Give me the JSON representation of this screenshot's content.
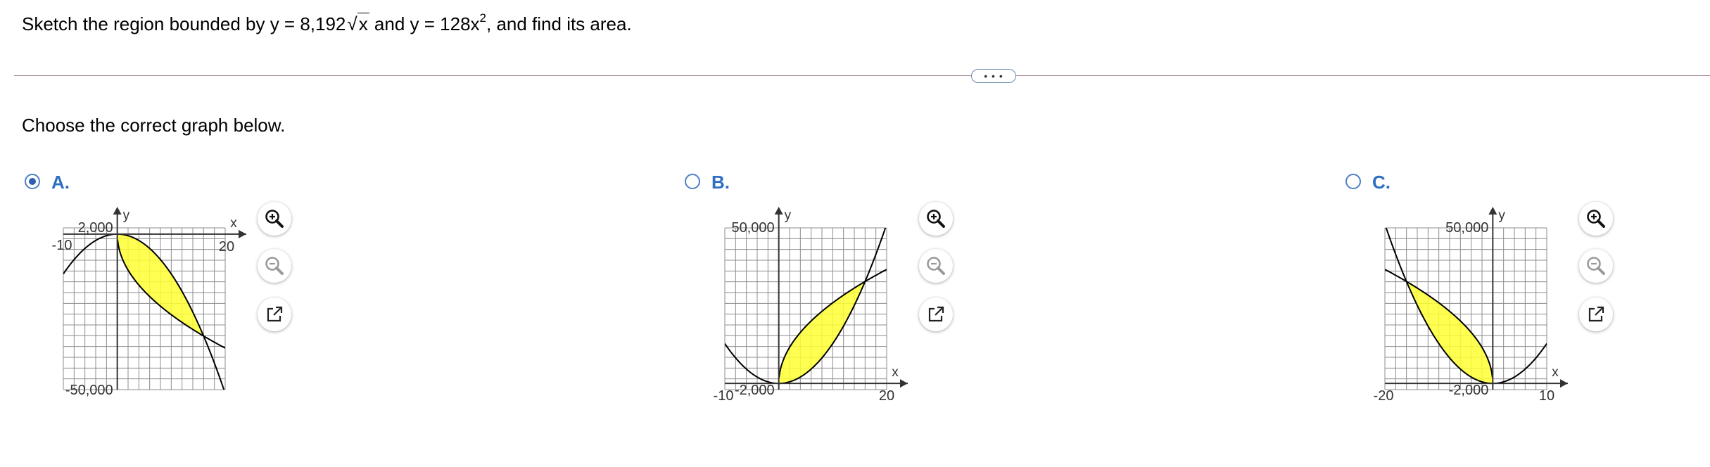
{
  "question": {
    "prefix": "Sketch the region bounded by y = 8,192",
    "radicand": "x",
    "middle": " and y = 128x",
    "exponent": "2",
    "suffix": ", and find its area."
  },
  "more_button": {
    "label": "• • •"
  },
  "prompt": "Choose the correct graph below.",
  "options": [
    {
      "letter": "A.",
      "selected": true,
      "chart": {
        "x_label": "x",
        "y_label": "y",
        "ticks": {
          "top_y": "2,000",
          "bottom_y": "-50,000",
          "left_x": "-10",
          "right_x": "20"
        }
      }
    },
    {
      "letter": "B.",
      "selected": false,
      "chart": {
        "x_label": "x",
        "y_label": "y",
        "ticks": {
          "top_y": "50,000",
          "bottom_y": "-2,000",
          "left_x": "-10",
          "right_x": "20"
        }
      }
    },
    {
      "letter": "C.",
      "selected": false,
      "chart": {
        "x_label": "x",
        "y_label": "y",
        "ticks": {
          "top_y": "50,000",
          "bottom_y": "-2,000",
          "left_x": "-20",
          "right_x": "10"
        }
      }
    }
  ],
  "chart_data": [
    {
      "type": "area",
      "title": "A",
      "xlim": [
        -10,
        20
      ],
      "ylim": [
        -50000,
        2000
      ],
      "series": [
        {
          "x": [
            -10,
            -5,
            0,
            5,
            10,
            15,
            20
          ],
          "y": [
            -12800,
            -3200,
            0,
            -3200,
            -12800,
            -28800,
            -51200
          ]
        },
        {
          "x": [
            0,
            5,
            10,
            15,
            20
          ],
          "y": [
            0,
            -18318,
            -25905,
            -31727,
            -36636
          ]
        }
      ],
      "shaded_between": [
        0,
        16
      ]
    },
    {
      "type": "area",
      "title": "B",
      "xlim": [
        -10,
        20
      ],
      "ylim": [
        -2000,
        50000
      ],
      "series": [
        {
          "x": [
            -10,
            -5,
            0,
            5,
            10,
            15,
            20
          ],
          "y": [
            12800,
            3200,
            0,
            3200,
            12800,
            28800,
            51200
          ]
        },
        {
          "x": [
            0,
            5,
            10,
            15,
            20
          ],
          "y": [
            0,
            18318,
            25905,
            31727,
            36636
          ]
        }
      ],
      "shaded_between": [
        0,
        16
      ]
    },
    {
      "type": "area",
      "title": "C",
      "xlim": [
        -20,
        10
      ],
      "ylim": [
        -2000,
        50000
      ],
      "series": [
        {
          "x": [
            -20,
            -15,
            -10,
            -5,
            0,
            5,
            10
          ],
          "y": [
            51200,
            28800,
            12800,
            3200,
            0,
            3200,
            12800
          ]
        },
        {
          "x": [
            -20,
            -15,
            -10,
            -5,
            0
          ],
          "y": [
            36636,
            31727,
            25905,
            18318,
            0
          ]
        }
      ],
      "shaded_between": [
        -16,
        0
      ]
    }
  ],
  "colors": {
    "fill": "#ffff33",
    "accent": "#2f6fc0"
  },
  "icons": {
    "zoom_in": "zoom-in-icon",
    "zoom_out": "zoom-out-icon",
    "popout": "popout-icon"
  }
}
